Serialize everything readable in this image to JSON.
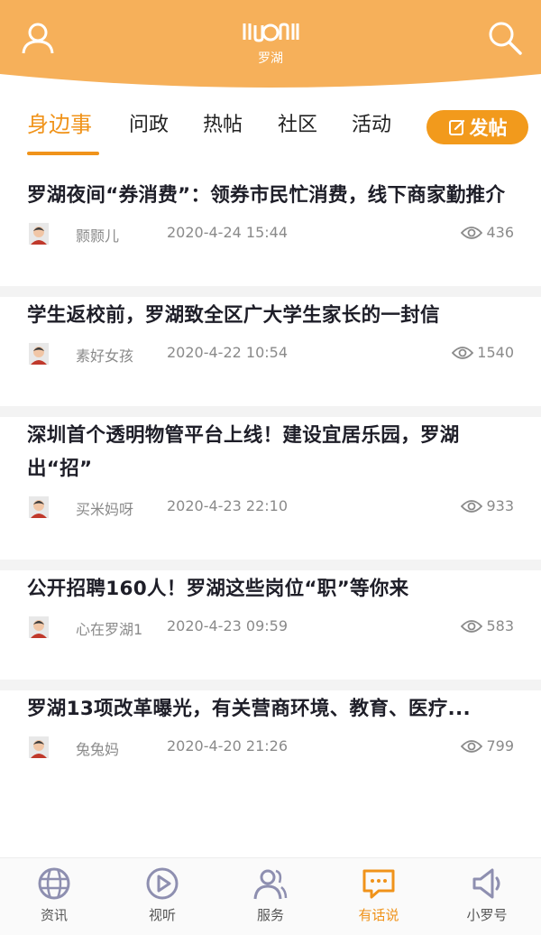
{
  "header": {
    "logo_text": "罗湖",
    "user_icon": "user-icon",
    "search_icon": "search-icon",
    "bg_color": "#f6b05a"
  },
  "tabs": [
    {
      "label": "身边事",
      "active": true
    },
    {
      "label": "问政",
      "active": false
    },
    {
      "label": "热帖",
      "active": false
    },
    {
      "label": "社区",
      "active": false
    },
    {
      "label": "活动",
      "active": false
    }
  ],
  "post_button": {
    "label": "发帖",
    "icon": "edit-icon",
    "color": "#f29a1c"
  },
  "posts": [
    {
      "title": "罗湖夜间“券消费”：领券市民忙消费，线下商家勤推介",
      "author": "颢颢儿",
      "date": "2020-4-24 15:44",
      "views": "436"
    },
    {
      "title": "学生返校前，罗湖致全区广大学生家长的一封信",
      "author": "素好女孩",
      "date": "2020-4-22 10:54",
      "views": "1540"
    },
    {
      "title": "深圳首个透明物管平台上线！建设宜居乐园，罗湖出“招”",
      "author": "买米妈呀",
      "date": "2020-4-23 22:10",
      "views": "933"
    },
    {
      "title": "公开招聘160人！罗湖这些岗位“职”等你来",
      "author": "心在罗湖1",
      "date": "2020-4-23 09:59",
      "views": "583"
    },
    {
      "title": "罗湖13项改革曝光，有关营商环境、教育、医疗...",
      "author": "兔兔妈",
      "date": "2020-4-20 21:26",
      "views": "799"
    }
  ],
  "bottom_nav": [
    {
      "label": "资讯",
      "icon": "globe-icon",
      "active": false
    },
    {
      "label": "视听",
      "icon": "play-icon",
      "active": false
    },
    {
      "label": "服务",
      "icon": "users-icon",
      "active": false
    },
    {
      "label": "有话说",
      "icon": "chat-icon",
      "active": true
    },
    {
      "label": "小罗号",
      "icon": "speaker-icon",
      "active": false
    }
  ],
  "colors": {
    "accent": "#f0931a",
    "text": "#1e1e28",
    "muted": "#8a8a8a"
  }
}
